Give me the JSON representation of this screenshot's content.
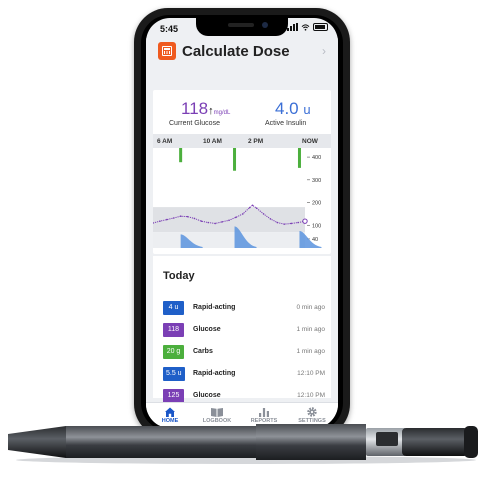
{
  "status_bar": {
    "time": "5:45"
  },
  "header": {
    "title": "Calculate Dose",
    "icon": "calculator-icon",
    "accent": "#ef5a1f"
  },
  "summary": {
    "glucose_value": "118",
    "glucose_unit": "mg/dL",
    "glucose_trend": "↑",
    "glucose_label": "Current Glucose",
    "insulin_value": "4.0",
    "insulin_unit": "u",
    "insulin_label": "Active Insulin"
  },
  "chart_data": {
    "type": "line",
    "x_ticks": [
      "6 AM",
      "10 AM",
      "2 PM",
      "NOW"
    ],
    "y_ticks": [
      400,
      300,
      200,
      100,
      40
    ],
    "ylim": [
      0,
      440
    ],
    "target_band": [
      70,
      180
    ],
    "colors": {
      "glucose": "#7b3fb5",
      "carbs": "#4caf3d",
      "insulin": "#5b93de"
    },
    "glucose": [
      {
        "x": 0,
        "y": 110
      },
      {
        "x": 0.5,
        "y": 118
      },
      {
        "x": 1,
        "y": 125
      },
      {
        "x": 1.5,
        "y": 132
      },
      {
        "x": 2,
        "y": 140
      },
      {
        "x": 2.5,
        "y": 138
      },
      {
        "x": 3,
        "y": 130
      },
      {
        "x": 3.5,
        "y": 118
      },
      {
        "x": 4,
        "y": 112
      },
      {
        "x": 4.5,
        "y": 108
      },
      {
        "x": 5,
        "y": 115
      },
      {
        "x": 5.5,
        "y": 122
      },
      {
        "x": 6,
        "y": 135
      },
      {
        "x": 6.5,
        "y": 150
      },
      {
        "x": 7,
        "y": 178
      },
      {
        "x": 7.2,
        "y": 188
      },
      {
        "x": 7.5,
        "y": 175
      },
      {
        "x": 8,
        "y": 150
      },
      {
        "x": 8.5,
        "y": 128
      },
      {
        "x": 9,
        "y": 112
      },
      {
        "x": 9.5,
        "y": 105
      },
      {
        "x": 10,
        "y": 108
      },
      {
        "x": 10.5,
        "y": 112
      },
      {
        "x": 11,
        "y": 118
      }
    ],
    "carbs": [
      {
        "x": 2.0,
        "value": 50
      },
      {
        "x": 5.9,
        "value": 80
      },
      {
        "x": 10.6,
        "value": 70
      }
    ],
    "insulin": [
      {
        "x": 2.0,
        "peak": 60
      },
      {
        "x": 5.9,
        "peak": 95
      },
      {
        "x": 10.6,
        "peak": 75
      }
    ],
    "x_range": [
      0,
      11
    ]
  },
  "today": {
    "title": "Today",
    "entries": [
      {
        "badge": "4 u",
        "label": "Rapid-acting",
        "time": "0 min ago",
        "color": "#1f5fc8"
      },
      {
        "badge": "118",
        "label": "Glucose",
        "time": "1 min ago",
        "color": "#7b3fb5"
      },
      {
        "badge": "20 g",
        "label": "Carbs",
        "time": "1 min ago",
        "color": "#4caf3d"
      },
      {
        "badge": "5.5 u",
        "label": "Rapid-acting",
        "time": "12:10 PM",
        "color": "#1f5fc8"
      },
      {
        "badge": "125",
        "label": "Glucose",
        "time": "12:10 PM",
        "color": "#7b3fb5"
      }
    ]
  },
  "tabs": [
    {
      "label": "HOME",
      "icon": "home-icon",
      "active": true
    },
    {
      "label": "LOGBOOK",
      "icon": "book-icon",
      "active": false
    },
    {
      "label": "REPORTS",
      "icon": "bar-chart-icon",
      "active": false
    },
    {
      "label": "SETTINGS",
      "icon": "gear-icon",
      "active": false
    }
  ]
}
